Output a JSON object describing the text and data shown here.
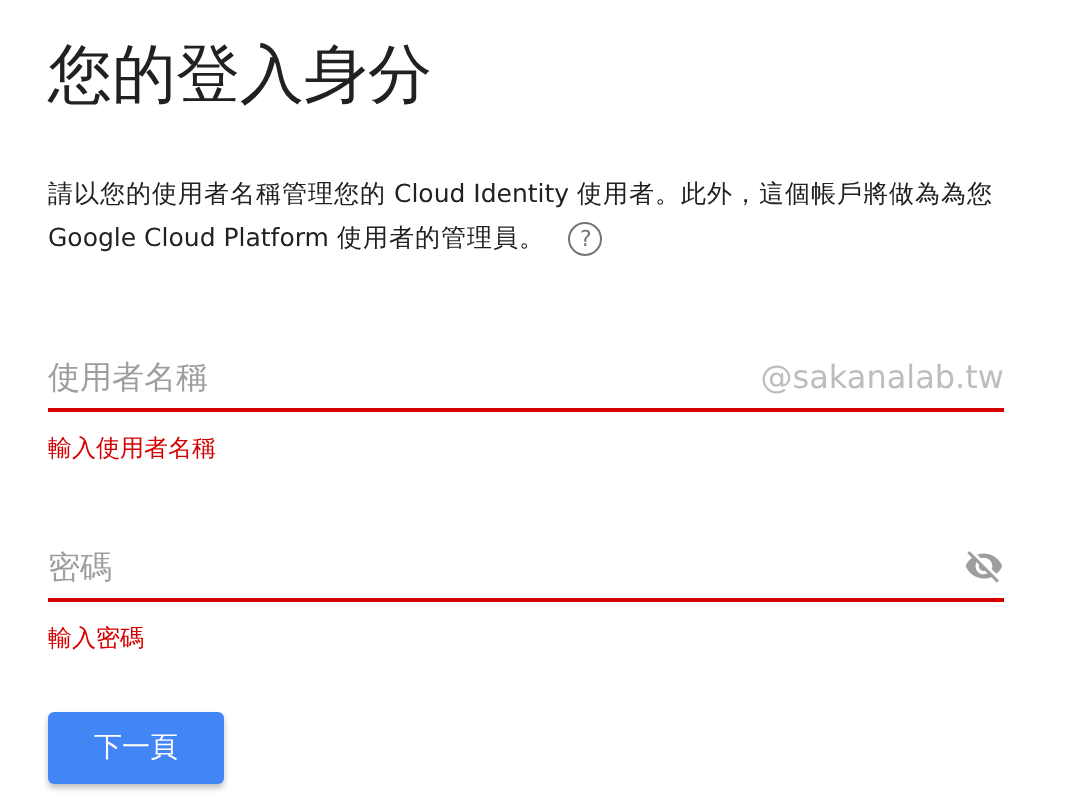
{
  "title": "您的登入身分",
  "description": "請以您的使用者名稱管理您的 Cloud Identity 使用者。此外，這個帳戶將做為為您 Google Cloud Platform 使用者的管理員。",
  "help_icon": "?",
  "fields": [
    {
      "kind": "text",
      "placeholder": "使用者名稱",
      "suffix": "@sakanalab.tw",
      "invalid": true,
      "error": "輸入使用者名稱"
    },
    {
      "kind": "password",
      "placeholder": "密碼",
      "invalid": true,
      "error": "輸入密碼"
    }
  ],
  "next_button": "下一頁"
}
